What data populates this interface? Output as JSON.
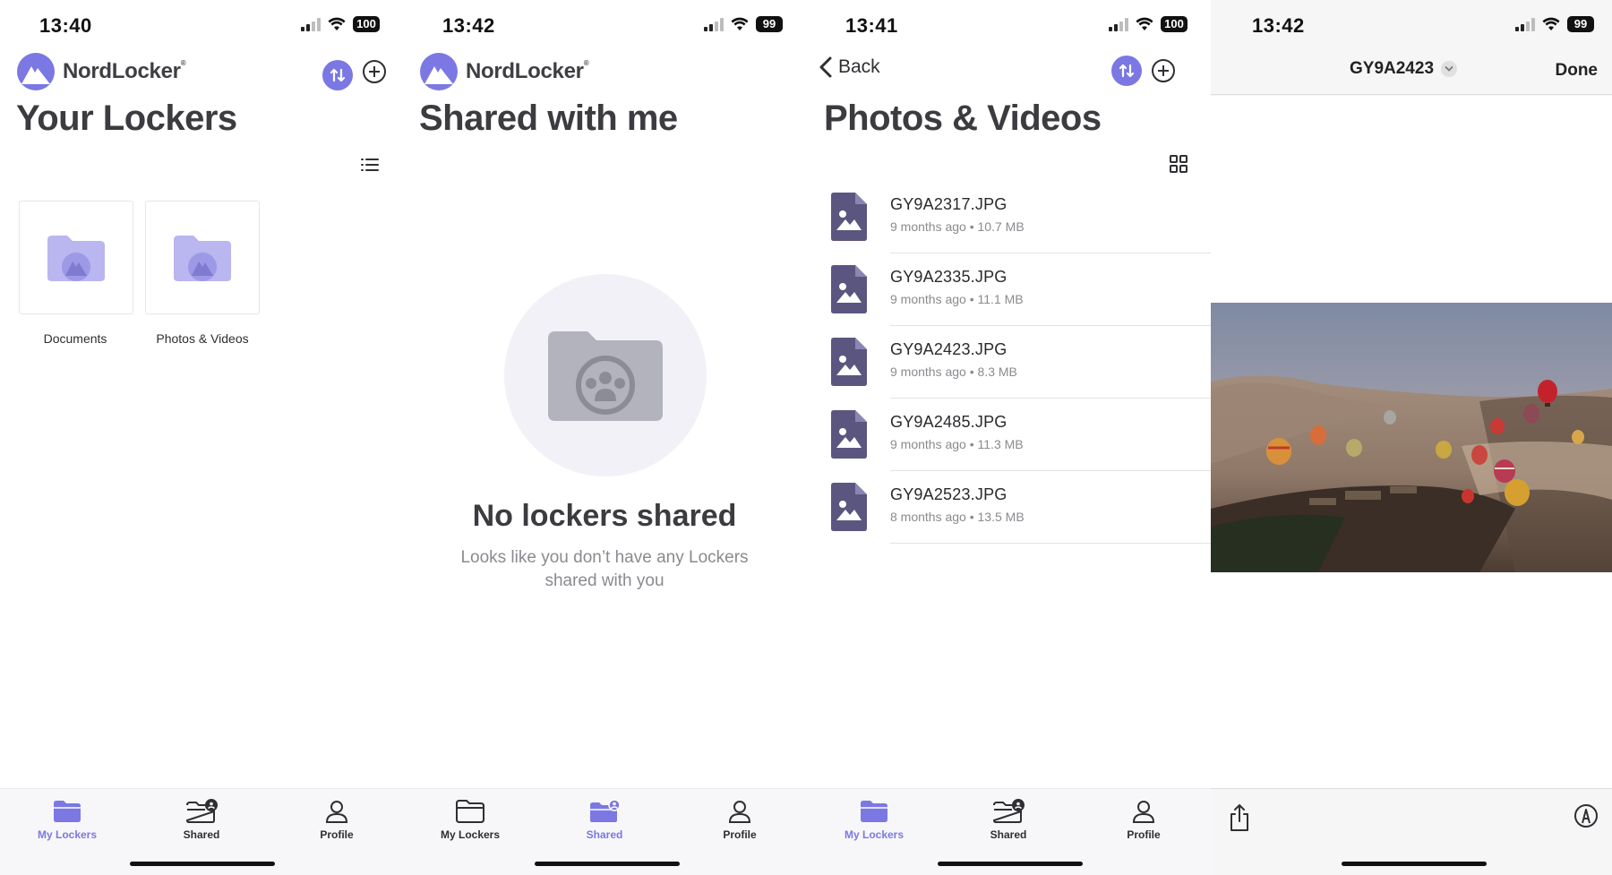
{
  "screens": {
    "lockers": {
      "time": "13:40",
      "battery": "100",
      "brand": "NordLocker",
      "title": "Your Lockers",
      "lockers": [
        {
          "label": "Documents"
        },
        {
          "label": "Photos & Videos"
        }
      ]
    },
    "shared": {
      "time": "13:42",
      "battery": "99",
      "brand": "NordLocker",
      "title": "Shared with me",
      "empty_title": "No lockers shared",
      "empty_subtitle": "Looks like you don’t have any Lockers shared with you"
    },
    "photos": {
      "time": "13:41",
      "battery": "100",
      "back_label": "Back",
      "title": "Photos & Videos",
      "files": [
        {
          "name": "GY9A2317.JPG",
          "meta": "9 months ago • 10.7 MB"
        },
        {
          "name": "GY9A2335.JPG",
          "meta": "9 months ago • 11.1 MB"
        },
        {
          "name": "GY9A2423.JPG",
          "meta": "9 months ago • 8.3 MB"
        },
        {
          "name": "GY9A2485.JPG",
          "meta": "9 months ago • 11.3 MB"
        },
        {
          "name": "GY9A2523.JPG",
          "meta": "8 months ago • 13.5 MB"
        }
      ]
    },
    "viewer": {
      "time": "13:42",
      "battery": "99",
      "title": "GY9A2423",
      "done_label": "Done"
    }
  },
  "tabbar": {
    "my_lockers": "My Lockers",
    "shared": "Shared",
    "profile": "Profile"
  },
  "colors": {
    "accent": "#7b78e3",
    "folder": "#b9b6f0",
    "file_icon": "#5b5680"
  },
  "icons": [
    "nordlocker-logo-icon",
    "sync-icon",
    "add-circle-icon",
    "list-view-icon",
    "grid-view-icon",
    "folder-icon",
    "shared-folder-icon",
    "profile-icon",
    "image-file-icon",
    "back-chevron-icon",
    "share-icon",
    "markup-icon"
  ]
}
